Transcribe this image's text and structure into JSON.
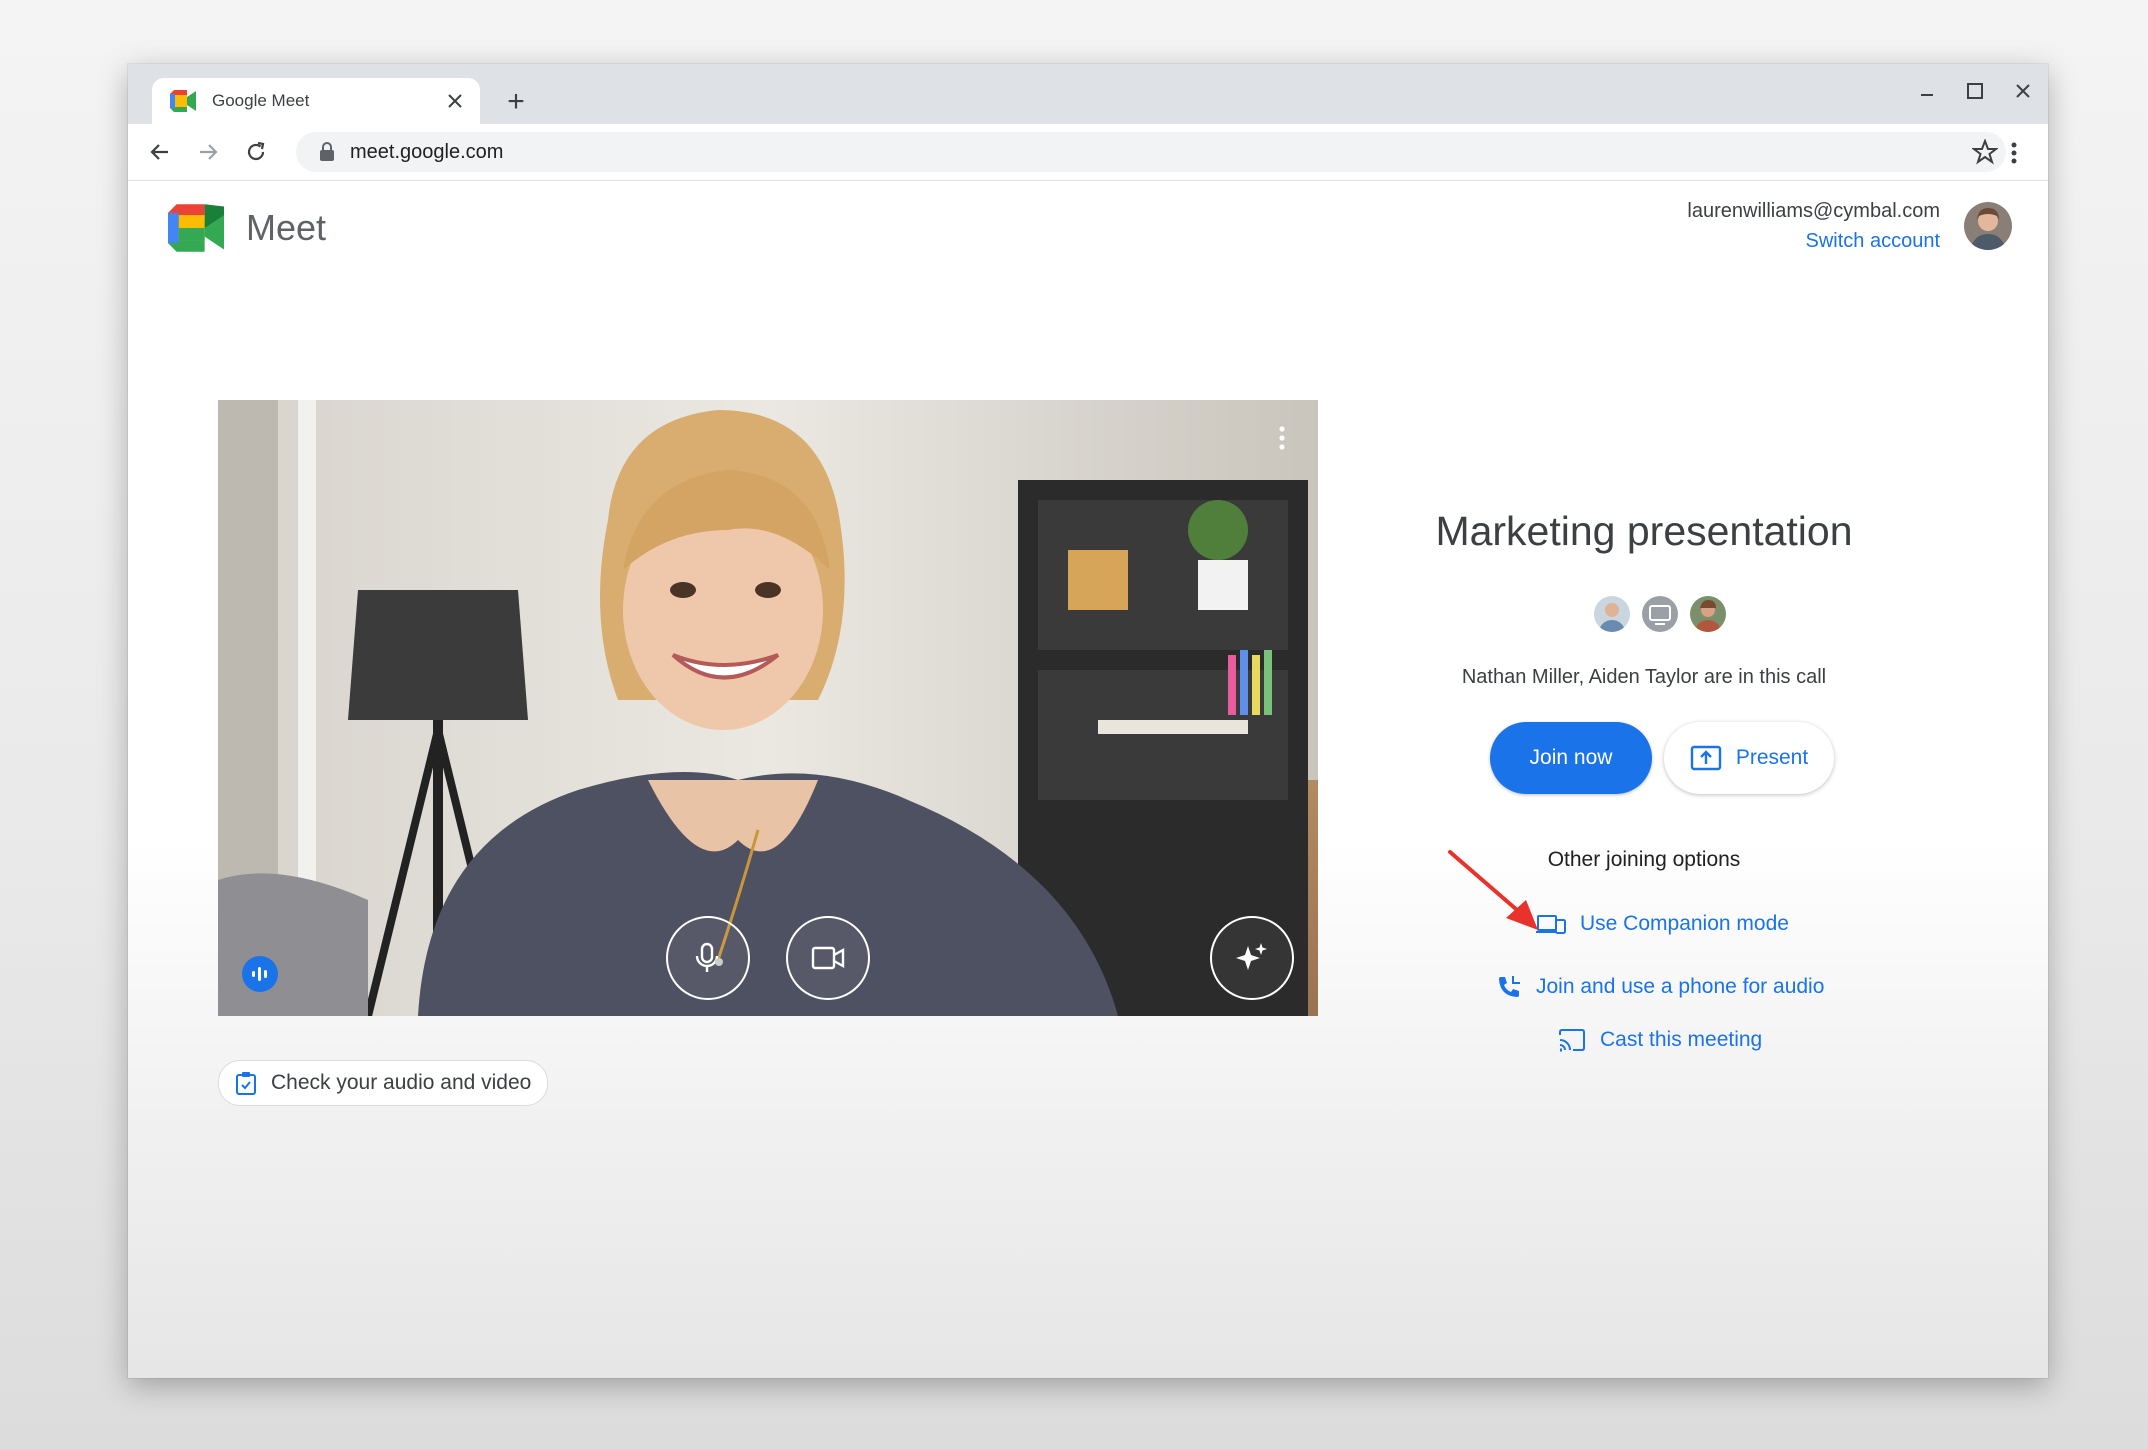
{
  "browser": {
    "tab_title": "Google Meet",
    "new_tab_label": "+",
    "url": "meet.google.com"
  },
  "header": {
    "app_name": "Meet",
    "account_email": "laurenwilliams@cymbal.com",
    "switch_account": "Switch account"
  },
  "meeting": {
    "title": "Marketing presentation",
    "in_call_text": "Nathan Miller, Aiden Taylor are in this call",
    "join_label": "Join now",
    "present_label": "Present"
  },
  "preview": {
    "check_av_label": "Check your audio and video"
  },
  "other_options": {
    "title": "Other joining options",
    "items": [
      {
        "label": "Use Companion mode",
        "icon": "companion-mode-icon"
      },
      {
        "label": "Join and use a phone for audio",
        "icon": "phone-audio-icon"
      },
      {
        "label": "Cast this meeting",
        "icon": "cast-icon"
      }
    ]
  },
  "colors": {
    "accent": "#1a73e8",
    "annotation_arrow": "#e8322c"
  }
}
